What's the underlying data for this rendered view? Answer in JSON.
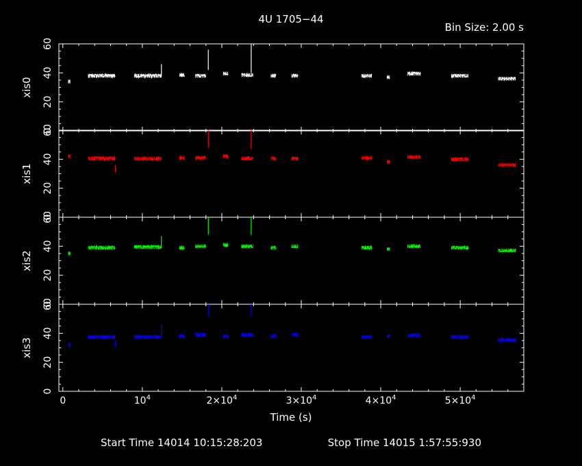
{
  "chart_data": {
    "type": "line",
    "title": "4U 1705−44",
    "bin_label": "Bin Size: 2.00 s",
    "xlabel": "Time (s)",
    "footer": {
      "start": "Start Time 14014 10:15:28:203",
      "stop": "Stop Time 14015  1:57:55:930"
    },
    "xlim": [
      -500,
      58000
    ],
    "ylim": [
      0,
      60
    ],
    "grid": false,
    "x_ticks": [
      {
        "value": 0,
        "base": "0",
        "exp": ""
      },
      {
        "value": 10000,
        "base": "10",
        "exp": "4"
      },
      {
        "value": 20000,
        "base": "2×10",
        "exp": "4"
      },
      {
        "value": 30000,
        "base": "3×10",
        "exp": "4"
      },
      {
        "value": 40000,
        "base": "4×10",
        "exp": "4"
      },
      {
        "value": 50000,
        "base": "5×10",
        "exp": "4"
      }
    ],
    "y_ticks": [
      "0",
      "20",
      "40",
      "60"
    ],
    "series": [
      {
        "name": "xis0",
        "color": "#ffffff",
        "segments": [
          {
            "x0": 700,
            "x1": 900,
            "y": 34,
            "n": 0.5
          },
          {
            "x0": 3200,
            "x1": 6600,
            "y": 38,
            "n": 1.2
          },
          {
            "x0": 9000,
            "x1": 12400,
            "y": 38,
            "n": 1.2
          },
          {
            "x0": 14700,
            "x1": 15300,
            "y": 38.5,
            "n": 1.0
          },
          {
            "x0": 16700,
            "x1": 18000,
            "y": 38,
            "n": 1.0
          },
          {
            "x0": 20200,
            "x1": 20800,
            "y": 39.5,
            "n": 1.0
          },
          {
            "x0": 22500,
            "x1": 23900,
            "y": 38.5,
            "n": 1.0
          },
          {
            "x0": 26200,
            "x1": 26800,
            "y": 38,
            "n": 1.0
          },
          {
            "x0": 28800,
            "x1": 29600,
            "y": 38,
            "n": 1.0
          },
          {
            "x0": 37600,
            "x1": 38900,
            "y": 38,
            "n": 1.2
          },
          {
            "x0": 40800,
            "x1": 41100,
            "y": 37,
            "n": 1.0
          },
          {
            "x0": 43400,
            "x1": 45000,
            "y": 39.5,
            "n": 1.0
          },
          {
            "x0": 48900,
            "x1": 51000,
            "y": 38,
            "n": 1.0
          },
          {
            "x0": 54800,
            "x1": 57000,
            "y": 36,
            "n": 0.8
          }
        ],
        "spikes": [
          {
            "x": 12400,
            "y0": 38,
            "y1": 46
          },
          {
            "x": 18300,
            "y0": 42,
            "y1": 56
          },
          {
            "x": 23700,
            "y0": 40,
            "y1": 60
          }
        ]
      },
      {
        "name": "xis1",
        "color": "#ff0000",
        "segments": [
          {
            "x0": 700,
            "x1": 900,
            "y": 42,
            "n": 1.0
          },
          {
            "x0": 3200,
            "x1": 6600,
            "y": 40.5,
            "n": 1.2
          },
          {
            "x0": 9000,
            "x1": 12400,
            "y": 40.5,
            "n": 1.2
          },
          {
            "x0": 14700,
            "x1": 15300,
            "y": 41,
            "n": 1.0
          },
          {
            "x0": 16700,
            "x1": 18000,
            "y": 41,
            "n": 1.0
          },
          {
            "x0": 20200,
            "x1": 20800,
            "y": 42,
            "n": 1.0
          },
          {
            "x0": 22500,
            "x1": 23900,
            "y": 40.5,
            "n": 1.0
          },
          {
            "x0": 26200,
            "x1": 26800,
            "y": 40.5,
            "n": 1.0
          },
          {
            "x0": 28800,
            "x1": 29600,
            "y": 40.5,
            "n": 1.0
          },
          {
            "x0": 37600,
            "x1": 38900,
            "y": 41,
            "n": 0.8
          },
          {
            "x0": 40800,
            "x1": 41100,
            "y": 38,
            "n": 1.0
          },
          {
            "x0": 43400,
            "x1": 45000,
            "y": 41.5,
            "n": 1.0
          },
          {
            "x0": 48900,
            "x1": 51000,
            "y": 40,
            "n": 1.0
          },
          {
            "x0": 54800,
            "x1": 57000,
            "y": 36,
            "n": 0.6
          }
        ],
        "spikes": [
          {
            "x": 6600,
            "y0": 36,
            "y1": 31
          },
          {
            "x": 18300,
            "y0": 48,
            "y1": 60
          },
          {
            "x": 23700,
            "y0": 47,
            "y1": 60
          }
        ]
      },
      {
        "name": "xis2",
        "color": "#00ff00",
        "segments": [
          {
            "x0": 700,
            "x1": 900,
            "y": 35,
            "n": 0.8
          },
          {
            "x0": 3200,
            "x1": 6600,
            "y": 39,
            "n": 1.2
          },
          {
            "x0": 9000,
            "x1": 12400,
            "y": 39.5,
            "n": 1.0
          },
          {
            "x0": 14700,
            "x1": 15300,
            "y": 39,
            "n": 1.0
          },
          {
            "x0": 16700,
            "x1": 18000,
            "y": 40,
            "n": 1.0
          },
          {
            "x0": 20200,
            "x1": 20800,
            "y": 41,
            "n": 1.0
          },
          {
            "x0": 22500,
            "x1": 23900,
            "y": 40,
            "n": 1.0
          },
          {
            "x0": 26200,
            "x1": 26800,
            "y": 39,
            "n": 1.0
          },
          {
            "x0": 28800,
            "x1": 29600,
            "y": 40,
            "n": 1.0
          },
          {
            "x0": 37600,
            "x1": 38900,
            "y": 39,
            "n": 1.2
          },
          {
            "x0": 40800,
            "x1": 41100,
            "y": 38,
            "n": 1.0
          },
          {
            "x0": 43400,
            "x1": 45000,
            "y": 40,
            "n": 1.0
          },
          {
            "x0": 48900,
            "x1": 51000,
            "y": 39,
            "n": 1.0
          },
          {
            "x0": 54800,
            "x1": 57000,
            "y": 37,
            "n": 0.8
          }
        ],
        "spikes": [
          {
            "x": 12400,
            "y0": 39,
            "y1": 47
          },
          {
            "x": 18300,
            "y0": 48,
            "y1": 60
          },
          {
            "x": 23700,
            "y0": 48,
            "y1": 60
          }
        ]
      },
      {
        "name": "xis3",
        "color": "#0000ff",
        "segments": [
          {
            "x0": 700,
            "x1": 900,
            "y": 32,
            "n": 1.0
          },
          {
            "x0": 3200,
            "x1": 6600,
            "y": 37.5,
            "n": 1.0
          },
          {
            "x0": 9000,
            "x1": 12400,
            "y": 37.5,
            "n": 1.0
          },
          {
            "x0": 14700,
            "x1": 15300,
            "y": 38,
            "n": 1.0
          },
          {
            "x0": 16700,
            "x1": 18000,
            "y": 39,
            "n": 1.0
          },
          {
            "x0": 20200,
            "x1": 20800,
            "y": 38,
            "n": 0.8
          },
          {
            "x0": 22500,
            "x1": 23900,
            "y": 39,
            "n": 1.0
          },
          {
            "x0": 26200,
            "x1": 26800,
            "y": 38,
            "n": 1.0
          },
          {
            "x0": 28800,
            "x1": 29600,
            "y": 39,
            "n": 1.0
          },
          {
            "x0": 37600,
            "x1": 38900,
            "y": 37.5,
            "n": 0.8
          },
          {
            "x0": 40800,
            "x1": 41100,
            "y": 38,
            "n": 1.0
          },
          {
            "x0": 43400,
            "x1": 45000,
            "y": 38.5,
            "n": 1.0
          },
          {
            "x0": 48900,
            "x1": 51000,
            "y": 37.5,
            "n": 0.8
          },
          {
            "x0": 54800,
            "x1": 57000,
            "y": 35.5,
            "n": 1.0
          }
        ],
        "spikes": [
          {
            "x": 6600,
            "y0": 35,
            "y1": 31
          },
          {
            "x": 12400,
            "y0": 38,
            "y1": 46
          },
          {
            "x": 18300,
            "y0": 52,
            "y1": 60
          },
          {
            "x": 23700,
            "y0": 52,
            "y1": 60
          }
        ]
      }
    ]
  }
}
